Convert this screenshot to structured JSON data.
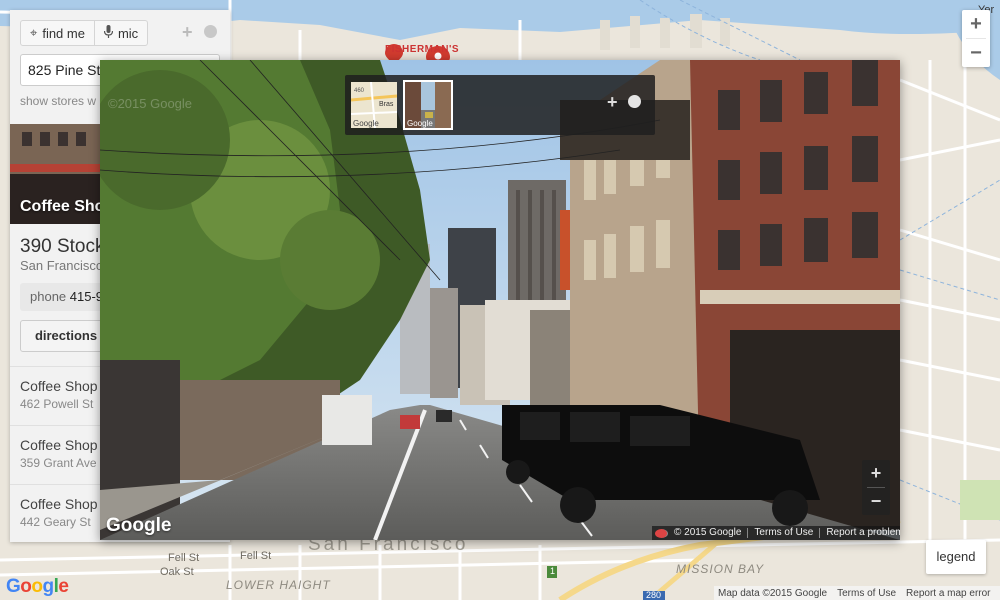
{
  "map": {
    "city_label": "San Francisco",
    "place_labels": [
      "FISHERMAN'S",
      "LOWER HAIGHT",
      "MISSION BAY"
    ],
    "street_labels": [
      "Fell St",
      "Oak St",
      "Fell St"
    ],
    "corner_label": "Yer",
    "route_labels": [
      "280",
      "1"
    ],
    "zoom_in": "+",
    "zoom_out": "−",
    "logo": "Google",
    "footer": {
      "map_data": "Map data ©2015 Google",
      "terms": "Terms of Use",
      "report": "Report a map error"
    },
    "legend_label": "legend",
    "colors": {
      "land": "#ebe6dc",
      "water": "#aacbe8",
      "road": "#ffffff",
      "accent_marker": "#d23b2f"
    }
  },
  "panel": {
    "find_me_label": "find me",
    "find_me_icon": "crosshair-icon",
    "mic_label": "mic",
    "mic_icon": "microphone-icon",
    "plus": "+",
    "address_value": "825 Pine St",
    "show_stores_text": "show stores w",
    "photo_label": "Coffee Shop",
    "store": {
      "address": "390 Stock",
      "city": "San Francisco",
      "phone_label": "phone",
      "phone_value": "415-9",
      "directions_label": "directions"
    },
    "list": [
      {
        "name": "Coffee Shop",
        "address": "462 Powell St"
      },
      {
        "name": "Coffee Shop",
        "address": "359 Grant Ave"
      },
      {
        "name": "Coffee Shop",
        "address": "442 Geary St"
      }
    ]
  },
  "streetview": {
    "thumb_labels": [
      "Google",
      "Google"
    ],
    "thumb_map_text": [
      "460",
      "Bras"
    ],
    "plus": "+",
    "zoom_in": "+",
    "zoom_out": "−",
    "logo": "Google",
    "watermark": "©2015 Google",
    "footer": {
      "copyright": "© 2015 Google",
      "terms": "Terms of Use",
      "report": "Report a problem"
    }
  }
}
